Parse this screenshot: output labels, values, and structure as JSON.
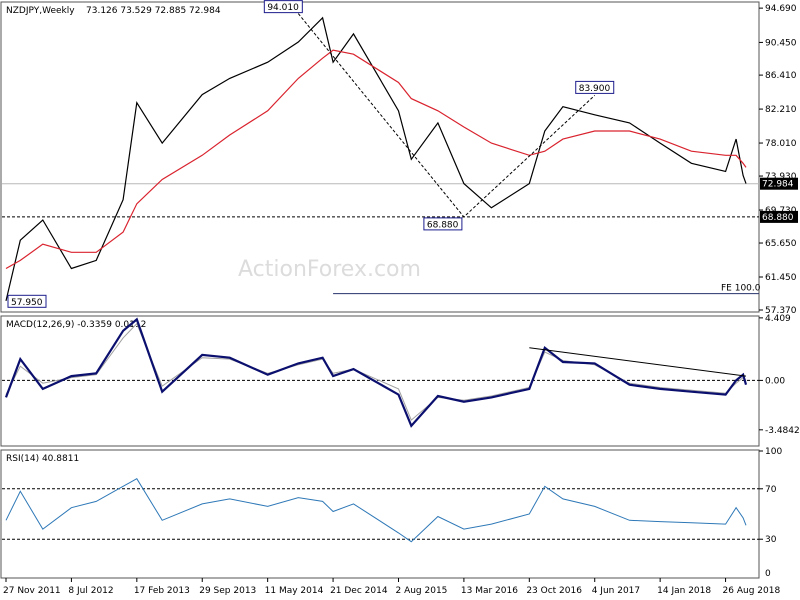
{
  "header": {
    "symbol": "NZDJPY,Weekly",
    "ohlc": "73.126 73.529 72.885 72.984"
  },
  "watermark": "ActionForex.com",
  "colors": {
    "price": "#000000",
    "ma": "#d9232e",
    "macd": "#0b0f6e",
    "signal": "#a0a0a0",
    "rsi": "#2e78b7",
    "label_border": "#1c1c8c",
    "fib": "#24336b"
  },
  "chart_data": [
    {
      "type": "line",
      "panel": "price",
      "ylim": [
        57.37,
        95.2
      ],
      "y_ticks": [
        "94.690",
        "90.450",
        "86.410",
        "82.210",
        "78.010",
        "73.930",
        "69.730",
        "65.650",
        "61.450",
        "57.370"
      ],
      "x_ticks": [
        "27 Nov 2011",
        "8 Jul 2012",
        "17 Feb 2013",
        "29 Sep 2013",
        "11 May 2014",
        "21 Dec 2014",
        "2 Aug 2015",
        "13 Mar 2016",
        "23 Oct 2016",
        "4 Jun 2017",
        "14 Jan 2018",
        "26 Aug 2018"
      ],
      "x": [
        "2011-11-27",
        "2012-01-15",
        "2012-04-01",
        "2012-07-08",
        "2012-10-01",
        "2013-01-01",
        "2013-02-17",
        "2013-05-15",
        "2013-09-29",
        "2014-01-01",
        "2014-05-11",
        "2014-08-24",
        "2014-11-15",
        "2014-12-21",
        "2015-03-01",
        "2015-08-02",
        "2015-09-15",
        "2015-12-15",
        "2016-03-13",
        "2016-06-15",
        "2016-10-23",
        "2016-12-15",
        "2017-02-15",
        "2017-06-04",
        "2017-10-01",
        "2018-01-14",
        "2018-05-01",
        "2018-08-26",
        "2018-10-01",
        "2018-10-25",
        "2018-11-04"
      ],
      "series": [
        {
          "role": "price",
          "values": [
            58.5,
            66.0,
            68.5,
            62.5,
            63.5,
            71.0,
            83.0,
            78.0,
            84.0,
            86.0,
            88.0,
            90.5,
            93.5,
            88.0,
            91.5,
            82.0,
            76.0,
            80.5,
            73.0,
            70.0,
            73.0,
            79.5,
            82.5,
            81.5,
            80.5,
            78.0,
            75.5,
            74.5,
            78.5,
            74.0,
            73.0
          ]
        },
        {
          "role": "moving-average",
          "values": [
            62.5,
            63.5,
            65.5,
            64.5,
            64.5,
            67.0,
            70.5,
            73.5,
            76.5,
            79.0,
            82.0,
            86.0,
            88.5,
            89.5,
            89.0,
            85.5,
            83.5,
            82.0,
            80.0,
            78.0,
            76.5,
            77.0,
            78.5,
            79.5,
            79.5,
            78.5,
            77.0,
            76.5,
            76.5,
            75.5,
            75.0
          ]
        }
      ],
      "annotations": [
        {
          "text": "94.010",
          "x": "2014-08-24",
          "y": 94.01
        },
        {
          "text": "68.880",
          "x": "2016-03-13",
          "y": 68.88
        },
        {
          "text": "83.900",
          "x": "2017-06-04",
          "y": 83.9
        },
        {
          "text": "57.950",
          "x": "2011-11-27",
          "y": 57.95
        }
      ],
      "fib_line": {
        "label": "FE 100.0",
        "y": 59.4,
        "x_start": "2014-12-21"
      },
      "last_price": {
        "label": "72.984",
        "y": 72.984
      },
      "support": {
        "label": "68.880",
        "y": 68.88
      }
    },
    {
      "type": "line",
      "panel": "macd",
      "title": "MACD(12,26,9) -0.3359 0.0112",
      "ylim": [
        -4.4842,
        4.4
      ],
      "y_ticks": [
        "4.409",
        "0.00",
        "-3.4842"
      ],
      "x": [
        "2011-11-27",
        "2012-01-15",
        "2012-04-01",
        "2012-07-08",
        "2012-10-01",
        "2013-01-01",
        "2013-02-17",
        "2013-05-15",
        "2013-09-29",
        "2014-01-01",
        "2014-05-11",
        "2014-08-24",
        "2014-11-15",
        "2014-12-21",
        "2015-03-01",
        "2015-08-02",
        "2015-09-15",
        "2015-12-15",
        "2016-03-13",
        "2016-06-15",
        "2016-10-23",
        "2016-12-15",
        "2017-02-15",
        "2017-06-04",
        "2017-10-01",
        "2018-01-14",
        "2018-05-01",
        "2018-08-26",
        "2018-10-01",
        "2018-10-25",
        "2018-11-04"
      ],
      "series": [
        {
          "role": "macd",
          "values": [
            -1.2,
            1.5,
            -0.6,
            0.3,
            0.5,
            3.5,
            4.3,
            -0.8,
            1.8,
            1.6,
            0.4,
            1.2,
            1.6,
            0.3,
            0.8,
            -1.0,
            -3.2,
            -1.1,
            -1.5,
            -1.2,
            -0.6,
            2.3,
            1.3,
            1.2,
            -0.3,
            -0.6,
            -0.8,
            -1.0,
            0.0,
            0.4,
            -0.3
          ]
        },
        {
          "role": "signal",
          "values": [
            -1.0,
            1.0,
            -0.2,
            0.2,
            0.4,
            3.0,
            4.0,
            -0.4,
            1.6,
            1.5,
            0.5,
            1.1,
            1.5,
            0.5,
            0.8,
            -0.6,
            -2.8,
            -1.2,
            -1.4,
            -1.1,
            -0.5,
            2.0,
            1.4,
            1.1,
            -0.2,
            -0.5,
            -0.7,
            -0.9,
            -0.2,
            0.2,
            0.0
          ]
        }
      ],
      "trendline": [
        {
          "x": "2016-10-23",
          "y": 2.3
        },
        {
          "x": "2018-11-04",
          "y": 0.3
        }
      ]
    },
    {
      "type": "line",
      "panel": "rsi",
      "title": "RSI(14) 40.8811",
      "ylim": [
        0,
        100
      ],
      "y_ticks": [
        "100",
        "70",
        "30",
        "0"
      ],
      "x": [
        "2011-11-27",
        "2012-01-15",
        "2012-04-01",
        "2012-07-08",
        "2012-10-01",
        "2013-01-01",
        "2013-02-17",
        "2013-05-15",
        "2013-09-29",
        "2014-01-01",
        "2014-05-11",
        "2014-08-24",
        "2014-11-15",
        "2014-12-21",
        "2015-03-01",
        "2015-08-02",
        "2015-09-15",
        "2015-12-15",
        "2016-03-13",
        "2016-06-15",
        "2016-10-23",
        "2016-12-15",
        "2017-02-15",
        "2017-06-04",
        "2017-10-01",
        "2018-01-14",
        "2018-05-01",
        "2018-08-26",
        "2018-10-01",
        "2018-10-25",
        "2018-11-04"
      ],
      "series": [
        {
          "role": "rsi",
          "values": [
            45,
            68,
            38,
            55,
            60,
            72,
            78,
            45,
            58,
            62,
            56,
            63,
            60,
            52,
            58,
            35,
            28,
            48,
            38,
            42,
            50,
            72,
            62,
            56,
            45,
            44,
            43,
            42,
            55,
            47,
            41
          ]
        }
      ]
    }
  ]
}
